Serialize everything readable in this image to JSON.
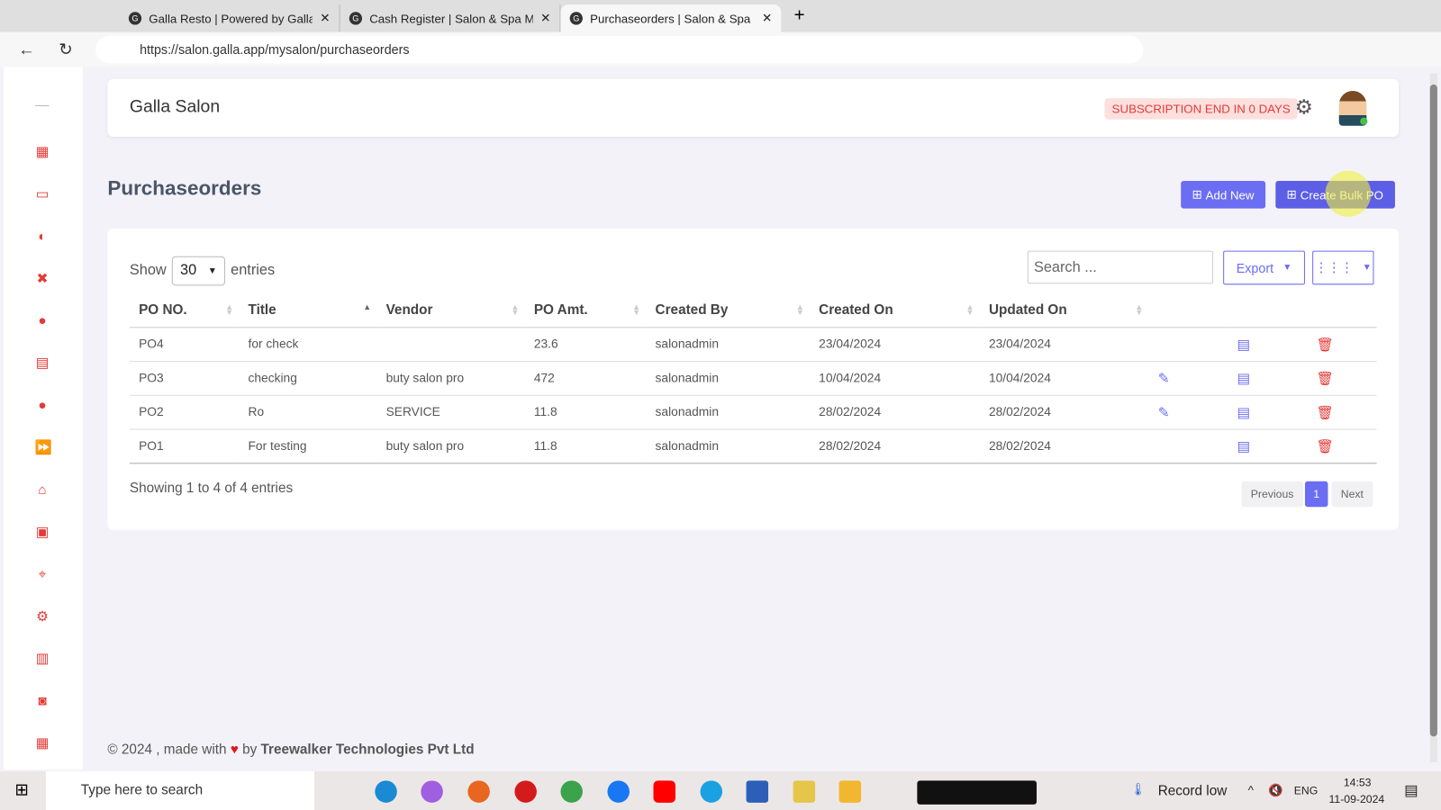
{
  "browser": {
    "tabs": [
      {
        "label": "Galla Resto | Powered by Galla"
      },
      {
        "label": "Cash Register | Salon & Spa Mana"
      },
      {
        "label": "Purchaseorders | Salon & Spa Mar"
      }
    ],
    "url": "https://salon.galla.app/mysalon/purchaseorders"
  },
  "header": {
    "brand": "Galla Salon",
    "subscription": "SUBSCRIPTION END IN 0 DAYS"
  },
  "page": {
    "title": "Purchaseorders",
    "add_new": "Add New",
    "create_bulk": "Create Bulk PO"
  },
  "table_controls": {
    "show": "Show",
    "entries_value": "30",
    "entries": "entries",
    "search_placeholder": "Search ...",
    "export": "Export"
  },
  "table": {
    "columns": [
      "PO NO.",
      "Title",
      "Vendor",
      "PO Amt.",
      "Created By",
      "Created On",
      "Updated On"
    ],
    "rows": [
      [
        "PO4",
        "for check",
        "",
        "23.6",
        "salonadmin",
        "23/04/2024",
        "23/04/2024"
      ],
      [
        "PO3",
        "checking",
        "buty salon pro",
        "472",
        "salonadmin",
        "10/04/2024",
        "10/04/2024"
      ],
      [
        "PO2",
        "Ro",
        "SERVICE",
        "11.8",
        "salonadmin",
        "28/02/2024",
        "28/02/2024"
      ],
      [
        "PO1",
        "For testing",
        "buty salon pro",
        "11.8",
        "salonadmin",
        "28/02/2024",
        "28/02/2024"
      ]
    ],
    "editable": [
      false,
      true,
      true,
      false
    ]
  },
  "pagination": {
    "info": "Showing 1 to 4 of 4 entries",
    "previous": "Previous",
    "current": "1",
    "next": "Next"
  },
  "footer": {
    "prefix": "© 2024 , made with",
    "by": "by",
    "company": "Treewalker Technologies Pvt Ltd"
  },
  "taskbar": {
    "search": "Type here to search",
    "weather": "Record low",
    "lang": "ENG",
    "time": "14:53",
    "date": "11-09-2024"
  },
  "colors": {
    "accent": "#6b6df2",
    "danger": "#e53935"
  }
}
